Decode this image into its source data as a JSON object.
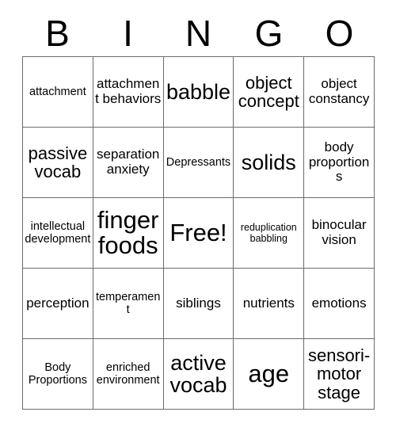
{
  "card": {
    "header_letters": [
      "B",
      "I",
      "N",
      "G",
      "O"
    ],
    "rows": [
      [
        {
          "text": "attachment",
          "size": "s"
        },
        {
          "text": "attachment behaviors",
          "size": "m"
        },
        {
          "text": "babble",
          "size": "xl"
        },
        {
          "text": "object concept",
          "size": "l"
        },
        {
          "text": "object constancy",
          "size": "m"
        }
      ],
      [
        {
          "text": "passive vocab",
          "size": "l"
        },
        {
          "text": "separation anxiety",
          "size": "m"
        },
        {
          "text": "Depressants",
          "size": "s"
        },
        {
          "text": "solids",
          "size": "xl"
        },
        {
          "text": "body proportions",
          "size": "m"
        }
      ],
      [
        {
          "text": "intellectual development",
          "size": "s"
        },
        {
          "text": "finger foods",
          "size": "xxl"
        },
        {
          "text": "Free!",
          "size": "xxl"
        },
        {
          "text": "reduplication babbling",
          "size": "xs"
        },
        {
          "text": "binocular vision",
          "size": "m"
        }
      ],
      [
        {
          "text": "perception",
          "size": "m"
        },
        {
          "text": "temperament",
          "size": "s"
        },
        {
          "text": "siblings",
          "size": "m"
        },
        {
          "text": "nutrients",
          "size": "m"
        },
        {
          "text": "emotions",
          "size": "m"
        }
      ],
      [
        {
          "text": "Body Proportions",
          "size": "s"
        },
        {
          "text": "enriched environment",
          "size": "s"
        },
        {
          "text": "active vocab",
          "size": "xl"
        },
        {
          "text": "age",
          "size": "xxl"
        },
        {
          "text": "sensori-motor stage",
          "size": "l"
        }
      ]
    ]
  },
  "colors": {
    "background": "#ffffff",
    "text": "#000000",
    "grid_line": "#6b6b6b"
  }
}
